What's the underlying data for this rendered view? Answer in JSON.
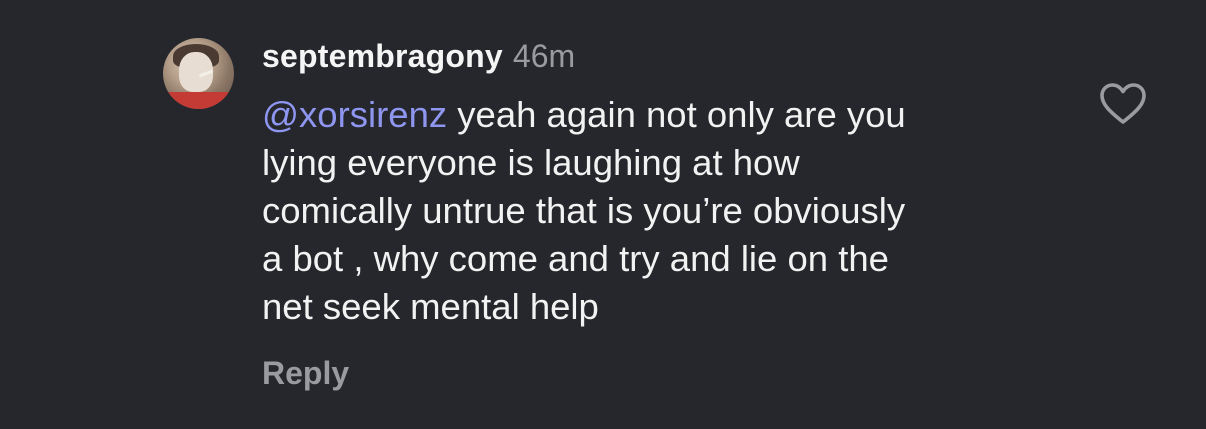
{
  "comment": {
    "username": "septembragony",
    "time": "46m",
    "mention": "@xorsirenz",
    "lines": [
      " yeah again not only are you",
      "lying everyone is laughing at how",
      "comically untrue that is you’re obviously",
      "a bot , why come and try and lie on the",
      "net seek mental help"
    ],
    "reply_label": "Reply",
    "icons": {
      "like": "heart-outline-icon"
    },
    "colors": {
      "background": "#25272c",
      "mention": "#8e96f0",
      "secondary": "#9a9ba0"
    }
  }
}
